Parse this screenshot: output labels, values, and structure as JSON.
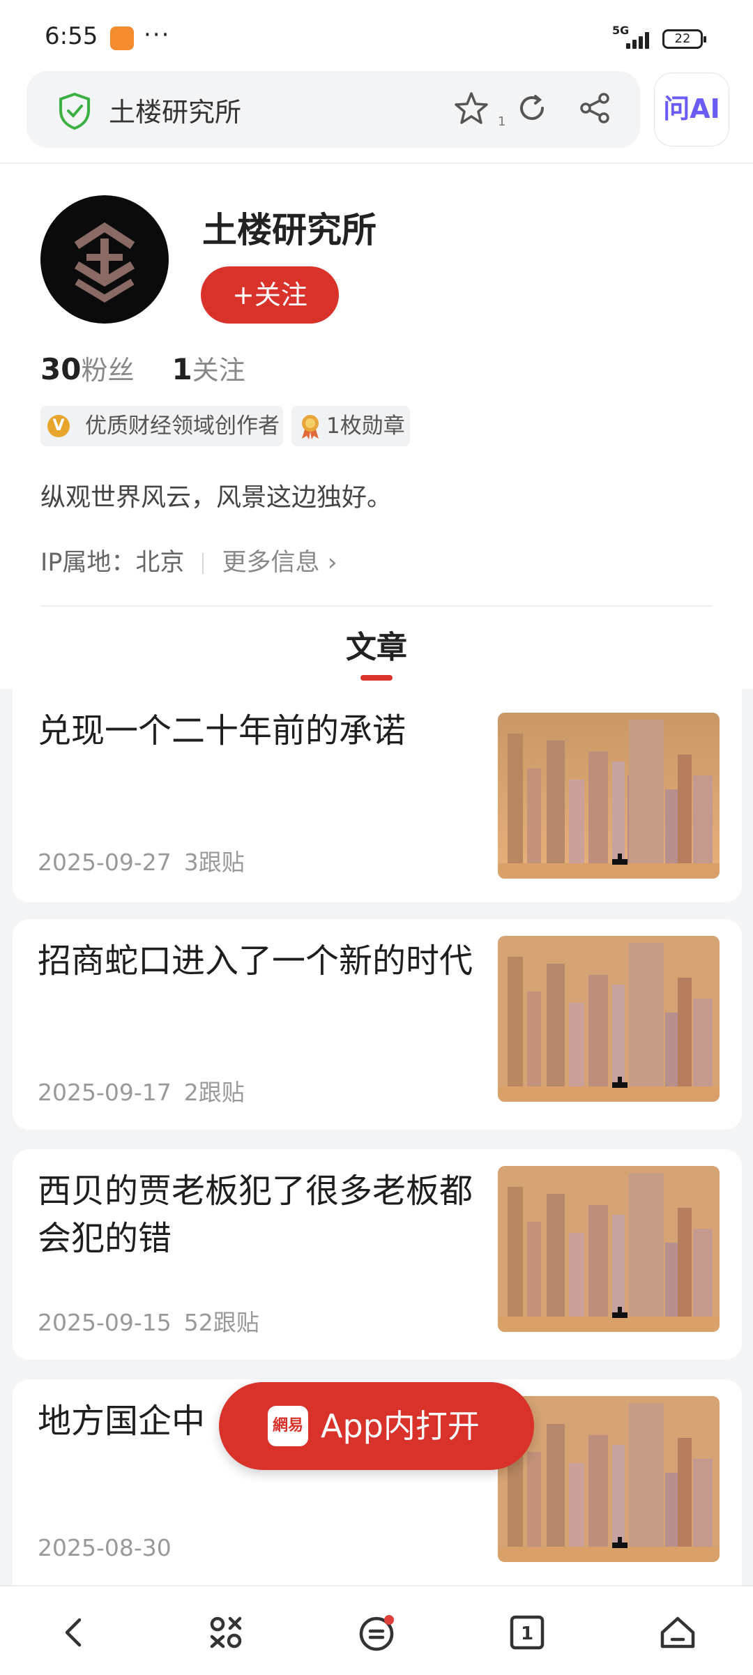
{
  "status_bar": {
    "time": "6:55",
    "more": "···",
    "network": "5G",
    "battery": "22"
  },
  "url_bar": {
    "title": "土楼研究所",
    "star_count": "1",
    "ai_label": "问AI"
  },
  "profile": {
    "name": "土楼研究所",
    "follow_label": "+关注",
    "fans_count": "30",
    "fans_label": "粉丝",
    "following_count": "1",
    "following_label": "关注",
    "badge_writer": "优质财经领域创作者",
    "badge_medal": "1枚勋章",
    "bio": "纵观世界风云，风景这边独好。",
    "ip_location": "IP属地：北京",
    "more_info": "更多信息 ›"
  },
  "tabs": {
    "articles": "文章"
  },
  "articles": [
    {
      "title": "兑现一个二十年前的承诺",
      "date": "2025-09-27",
      "comments": "3跟贴"
    },
    {
      "title": "招商蛇口进入了一个新的时代",
      "date": "2025-09-17",
      "comments": "2跟贴"
    },
    {
      "title": "西贝的贾老板犯了很多老板都会犯的错",
      "date": "2025-09-15",
      "comments": "52跟贴"
    },
    {
      "title": "地方国企中",
      "date": "2025-08-30",
      "comments": ""
    }
  ],
  "open_app": {
    "label": "App内打开",
    "logo_text": "網易"
  },
  "bottom_nav": [
    "back-icon",
    "apps-icon",
    "menu-icon",
    "tabs-icon",
    "home-icon"
  ],
  "colors": {
    "accent": "#d8322b",
    "background": "#f3f4f6",
    "shield": "#3cb043",
    "ai": "#6a5cf5"
  }
}
